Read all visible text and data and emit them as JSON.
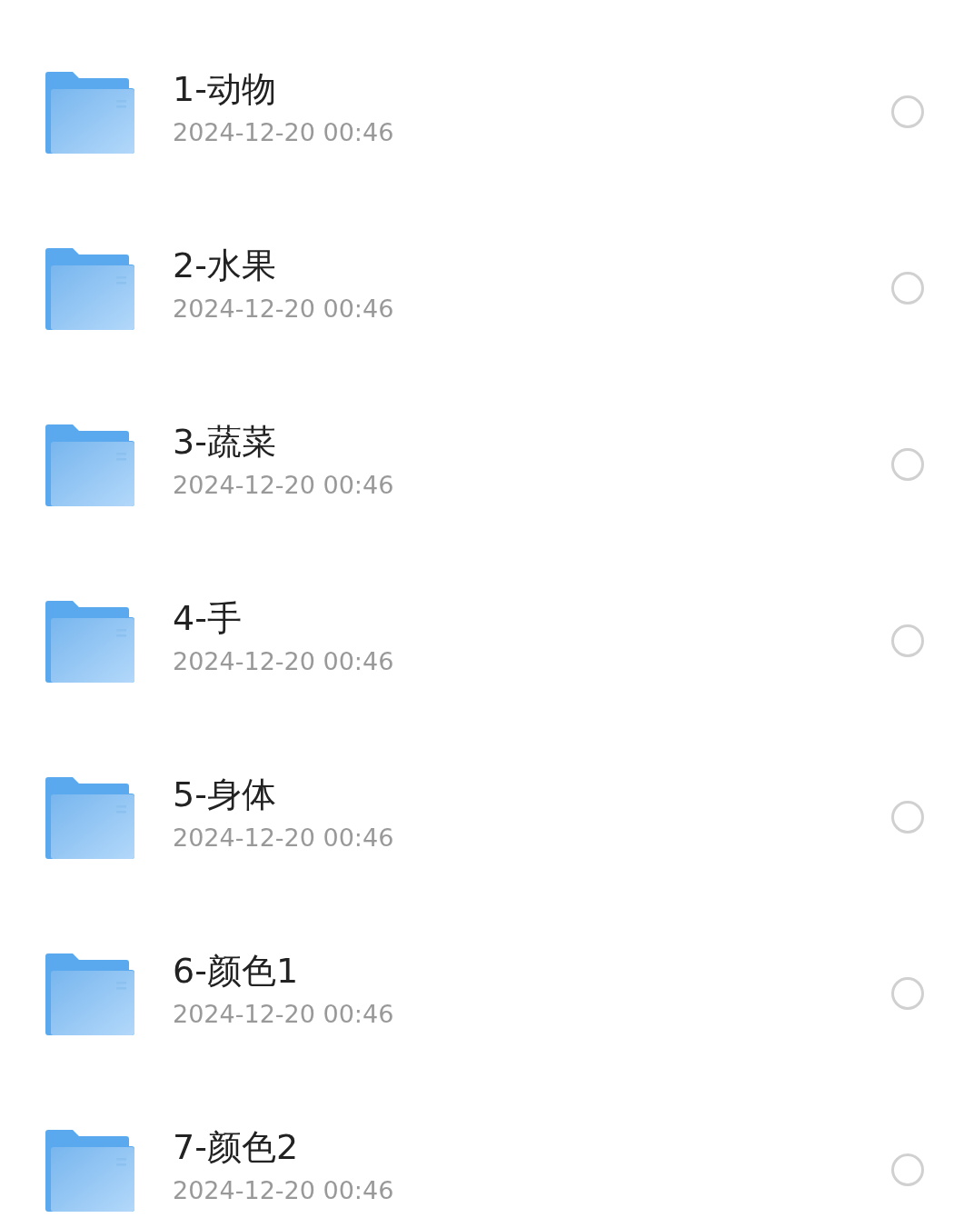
{
  "folders": [
    {
      "name": "1-动物",
      "date": "2024-12-20 00:46",
      "selected": false
    },
    {
      "name": "2-水果",
      "date": "2024-12-20 00:46",
      "selected": false
    },
    {
      "name": "3-蔬菜",
      "date": "2024-12-20 00:46",
      "selected": false
    },
    {
      "name": "4-手",
      "date": "2024-12-20 00:46",
      "selected": false
    },
    {
      "name": "5-身体",
      "date": "2024-12-20 00:46",
      "selected": false
    },
    {
      "name": "6-颜色1",
      "date": "2024-12-20 00:46",
      "selected": false
    },
    {
      "name": "7-颜色2",
      "date": "2024-12-20 00:46",
      "selected": false
    }
  ]
}
